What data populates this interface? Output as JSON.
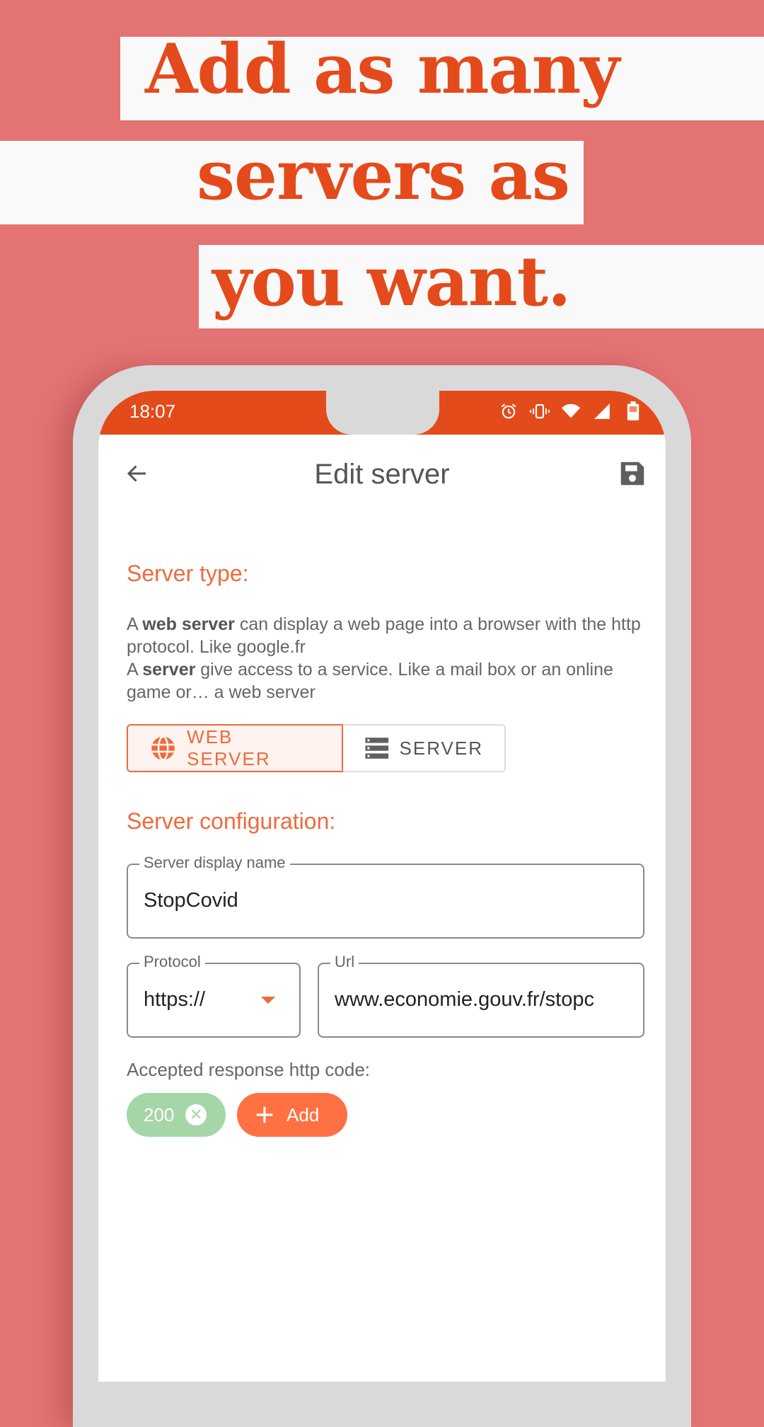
{
  "headline": {
    "line1": "Add as many",
    "line2": "servers as",
    "line3": "you want."
  },
  "status_bar": {
    "time": "18:07",
    "icons": [
      "alarm-icon",
      "vibrate-icon",
      "wifi-icon",
      "signal-icon",
      "battery-icon"
    ]
  },
  "app_bar": {
    "back_icon": "arrow-left-icon",
    "title": "Edit server",
    "save_icon": "floppy-save-icon"
  },
  "server_type": {
    "heading": "Server type:",
    "description": {
      "p1_prefix": "A ",
      "p1_bold": "web server",
      "p1_rest": " can display a web page into a browser with the http protocol. Like google.fr",
      "p2_prefix": "A ",
      "p2_bold": "server",
      "p2_rest": " give access to a service. Like a mail box or an online game or… a web server"
    },
    "options": [
      {
        "label": "WEB SERVER",
        "icon": "globe-icon",
        "selected": true
      },
      {
        "label": "SERVER",
        "icon": "server-rack-icon",
        "selected": false
      }
    ]
  },
  "server_configuration": {
    "heading": "Server configuration:",
    "display_name": {
      "label": "Server display name",
      "value": "StopCovid"
    },
    "protocol": {
      "label": "Protocol",
      "value": "https://"
    },
    "url": {
      "label": "Url",
      "value": "www.economie.gouv.fr/stopc"
    }
  },
  "accepted_codes": {
    "label": "Accepted response http code:",
    "codes": [
      "200"
    ],
    "add_label": "Add"
  },
  "colors": {
    "background": "#e47373",
    "accent": "#e44b1a",
    "section_heading": "#f06a3b",
    "chip_code": "#a5d6a7",
    "chip_add": "#ff7043"
  }
}
